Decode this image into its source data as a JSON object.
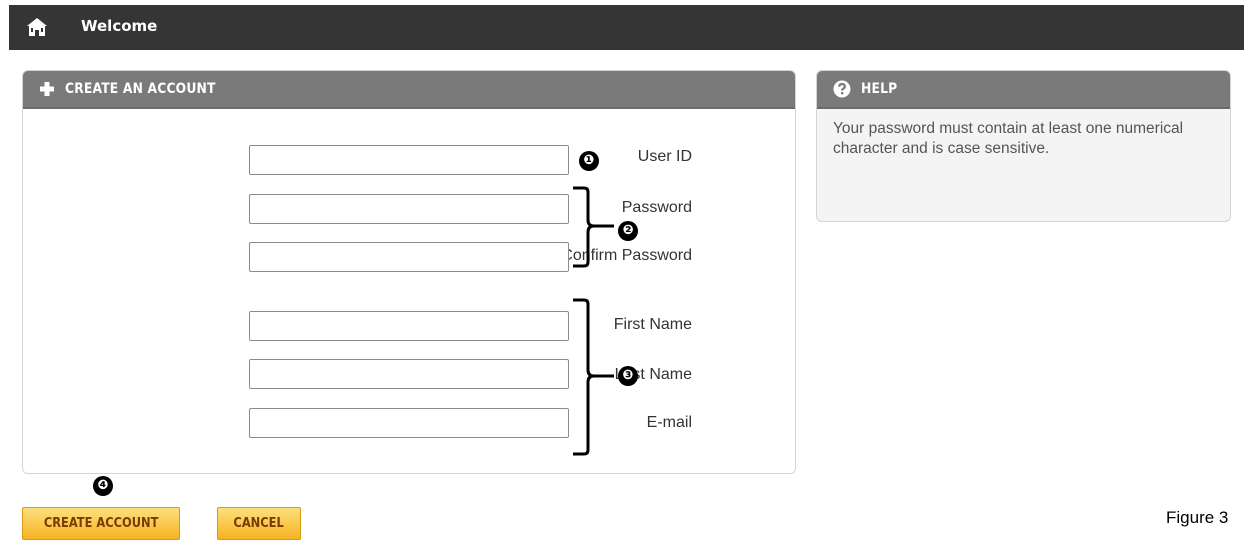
{
  "topbar": {
    "title": "Welcome",
    "icon": "home-icon"
  },
  "create_panel": {
    "title": "CREATE AN ACCOUNT",
    "icon": "plus-icon",
    "fields": [
      {
        "label": "User ID",
        "value": ""
      },
      {
        "label": "Password",
        "value": ""
      },
      {
        "label": "Confirm Password",
        "value": ""
      },
      {
        "label": "First Name",
        "value": ""
      },
      {
        "label": "Last Name",
        "value": ""
      },
      {
        "label": "E-mail",
        "value": ""
      }
    ]
  },
  "help_panel": {
    "title": "HELP",
    "icon": "question-circle-icon",
    "text": "Your password must contain at least one numerical character and is case sensitive."
  },
  "callouts": [
    "❶",
    "❷",
    "❸",
    "❹"
  ],
  "buttons": {
    "create": "CREATE ACCOUNT",
    "cancel": "CANCEL"
  },
  "figure_label": "Figure 3",
  "colors": {
    "topbar": "#353535",
    "panel_header": "#7a7a7a",
    "button_fill": "#f6b322",
    "button_text": "#7a3b00"
  }
}
